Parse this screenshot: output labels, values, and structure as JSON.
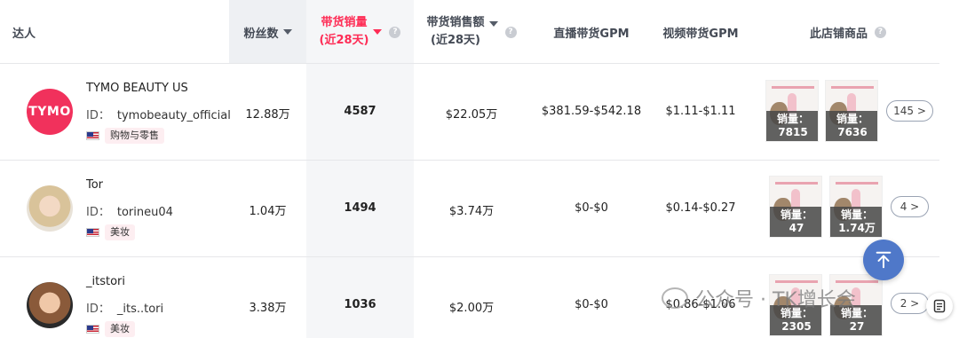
{
  "header": {
    "influencer": "达人",
    "fans": "粉丝数",
    "sales_line1": "带货销量",
    "sales_line2": "(近28天)",
    "revenue_line1": "带货销售额",
    "revenue_line2": "(近28天)",
    "live_gpm": "直播带货GPM",
    "video_gpm": "视频带货GPM",
    "shop_products": "此店铺商品"
  },
  "rows": [
    {
      "avatar_text": "TYMO",
      "name": "TYMO BEAUTY US",
      "id_label": "ID：",
      "id": "tymobeauty_official",
      "tag": "购物与零售",
      "fans": "12.88万",
      "sales": "4587",
      "revenue": "$22.05万",
      "live_gpm": "$381.59-$542.18",
      "video_gpm": "$1.11-$1.11",
      "products": [
        {
          "label": "销量：",
          "value": "7815"
        },
        {
          "label": "销量：",
          "value": "7636"
        }
      ],
      "more": "145 >"
    },
    {
      "name": "Tor",
      "id_label": "ID：",
      "id": "torineu04",
      "tag": "美妆",
      "fans": "1.04万",
      "sales": "1494",
      "revenue": "$3.74万",
      "live_gpm": "$0-$0",
      "video_gpm": "$0.14-$0.27",
      "products": [
        {
          "label": "销量：",
          "value": "47"
        },
        {
          "label": "销量：",
          "value": "1.74万"
        }
      ],
      "more": "4 >"
    },
    {
      "name": "_itstori",
      "id_label": "ID：",
      "id": "_its..tori",
      "tag": "美妆",
      "fans": "3.38万",
      "sales": "1036",
      "revenue": "$2.00万",
      "live_gpm": "$0-$0",
      "video_gpm": "$0.86-$1.06",
      "products": [
        {
          "label": "销量：",
          "value": "2305"
        },
        {
          "label": "销量：",
          "value": "27"
        }
      ],
      "more": "2 >"
    }
  ],
  "watermark": "公众号 · TK增长会",
  "colors": {
    "accent": "#fe2c55",
    "scroll_button": "#4f78c9",
    "tag_bg": "#fdeef1"
  },
  "icons": {
    "scroll_top": "arrow-up-icon",
    "help": "question-icon",
    "sort": "caret-down-icon",
    "flag": "us-flag-icon",
    "side": "document-icon"
  }
}
